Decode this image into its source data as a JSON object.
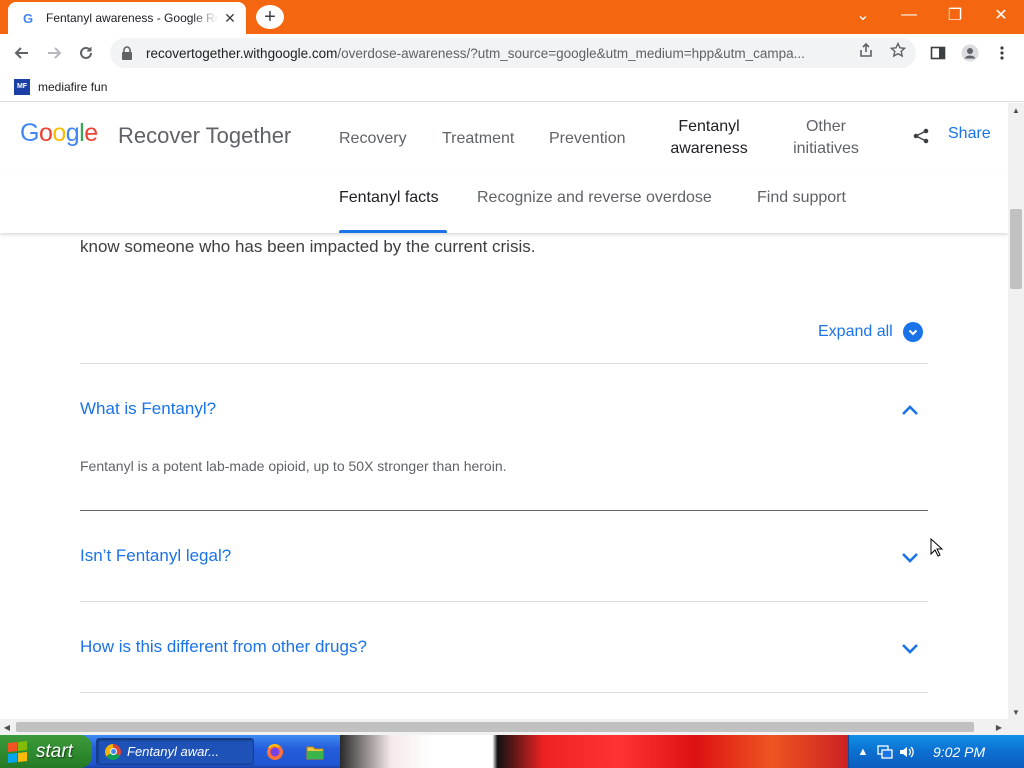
{
  "browser": {
    "tab_title": "Fentanyl awareness - Google Re",
    "tab_close_glyph": "✕",
    "newtab_glyph": "+",
    "window_controls": {
      "dropdown": "⌄",
      "minimize": "—",
      "restore": "❐",
      "close": "✕"
    },
    "url_host": "recovertogether.withgoogle.com",
    "url_path": "/overdose-awareness/?utm_source=google&utm_medium=hpp&utm_campa...",
    "bookmark_label": "mediafire fun",
    "bookmark_icon_text": "MF"
  },
  "site": {
    "logo_letters": [
      {
        "ch": "G",
        "color": "#4285f4"
      },
      {
        "ch": "o",
        "color": "#ea4335"
      },
      {
        "ch": "o",
        "color": "#fbbc05"
      },
      {
        "ch": "g",
        "color": "#4285f4"
      },
      {
        "ch": "l",
        "color": "#34a853"
      },
      {
        "ch": "e",
        "color": "#ea4335"
      }
    ],
    "name": "Recover Together",
    "nav": {
      "recovery": "Recovery",
      "treatment": "Treatment",
      "prevention": "Prevention",
      "fentanyl_line1": "Fentanyl",
      "fentanyl_line2": "awareness",
      "other_line1": "Other",
      "other_line2": "initiatives"
    },
    "share_label": "Share",
    "subnav": {
      "facts": "Fentanyl facts",
      "recognize": "Recognize and reverse overdose",
      "support": "Find support"
    }
  },
  "content": {
    "intro_text": "know someone who has been impacted by the current crisis.",
    "expand_all": "Expand all",
    "faqs": [
      {
        "question": "What is Fentanyl?",
        "answer": "Fentanyl is a potent lab-made opioid, up to 50X stronger than heroin.",
        "expanded": true
      },
      {
        "question": "Isn’t Fentanyl legal?",
        "expanded": false
      },
      {
        "question": "How is this different from other drugs?",
        "expanded": false
      }
    ]
  },
  "taskbar": {
    "start_label": "start",
    "window_label": "Fentanyl awar...",
    "clock": "9:02 PM"
  },
  "colors": {
    "chrome_frame": "#f4660f",
    "link_blue": "#1a73e8",
    "taskbar_blue": "#245edc",
    "start_green": "#2f8b2f"
  }
}
